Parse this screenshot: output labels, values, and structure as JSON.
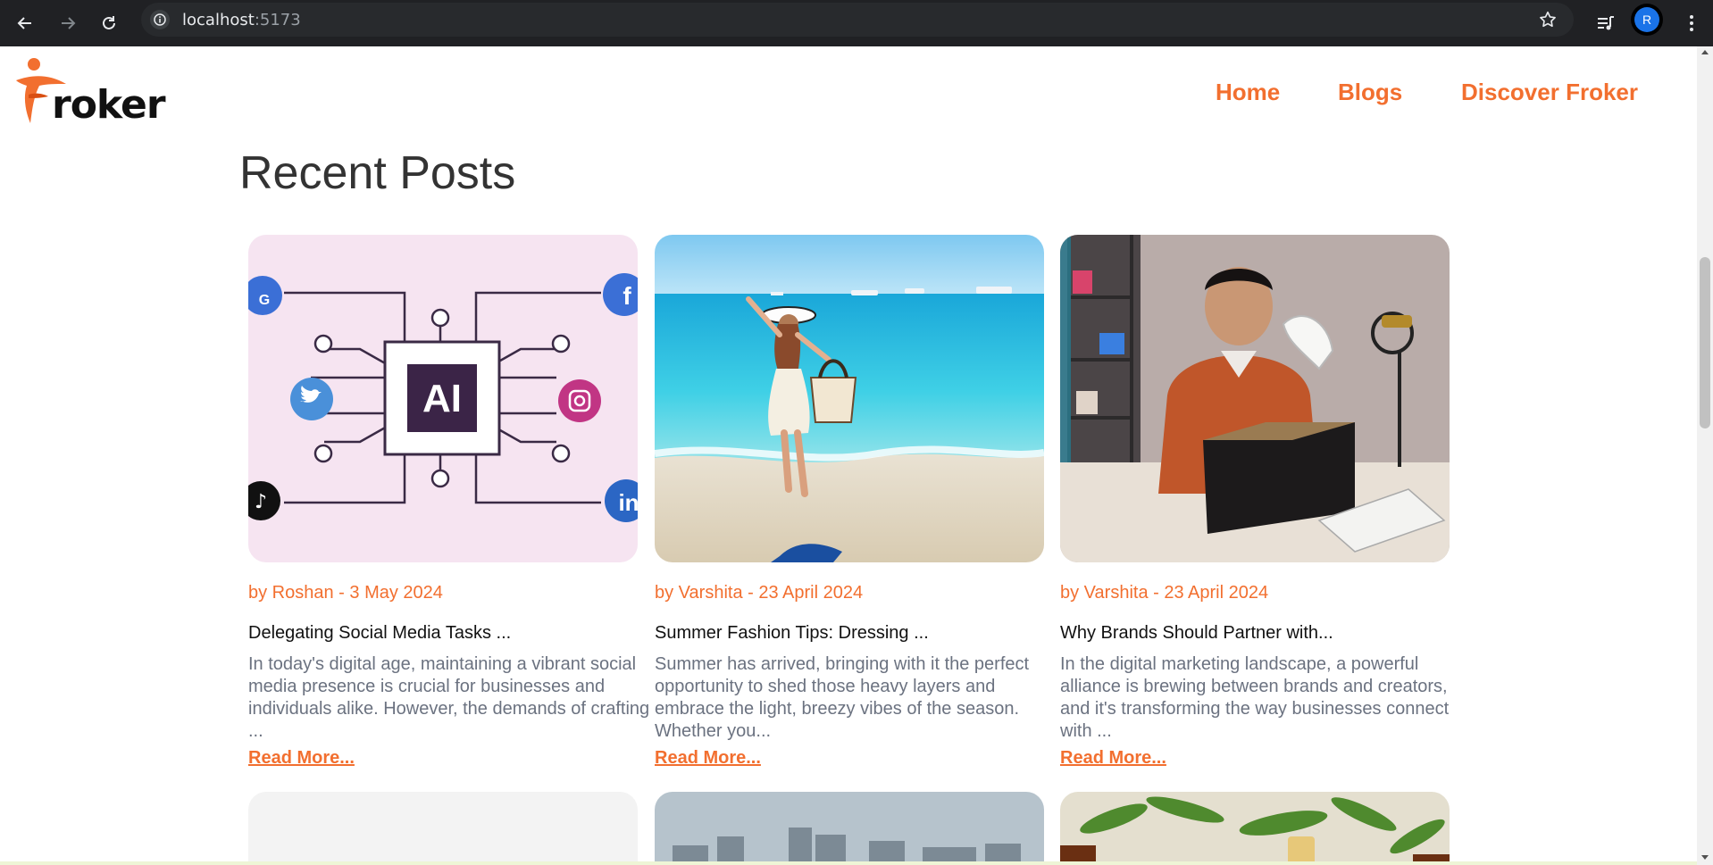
{
  "browser": {
    "url_host": "localhost",
    "url_port": ":5173",
    "avatar_letter": "R"
  },
  "brand": {
    "logo_text": "roker",
    "accent": "#f26f2f"
  },
  "nav": {
    "items": [
      "Home",
      "Blogs",
      "Discover Froker"
    ]
  },
  "section": {
    "title": "Recent Posts"
  },
  "posts": [
    {
      "meta": "by Roshan - 3 May 2024",
      "title": "Delegating Social Media Tasks ...",
      "excerpt": "In today's digital age, maintaining a vibrant social media presence is crucial for businesses and individuals alike. However, the demands of crafting ...",
      "read_more": "Read More...",
      "image": "ai-social-media-illustration",
      "image_text": "AI"
    },
    {
      "meta": "by Varshita - 23 April 2024",
      "title": "Summer Fashion Tips: Dressing ...",
      "excerpt": "Summer has arrived, bringing with it the perfect opportunity to shed those heavy layers and embrace the light, breezy vibes of the season. Whether you...",
      "read_more": "Read More...",
      "image": "beach-woman-photo"
    },
    {
      "meta": "by Varshita - 23 April 2024",
      "title": "Why Brands Should Partner with...",
      "excerpt": "In the digital marketing landscape, a powerful alliance is brewing between brands and creators, and it's transforming the way businesses connect with ...",
      "read_more": "Read More...",
      "image": "creator-unboxing-shoe-photo"
    }
  ],
  "next_row": [
    "blank-image",
    "city-skyline-photo",
    "herbs-oil-bottles-photo"
  ]
}
